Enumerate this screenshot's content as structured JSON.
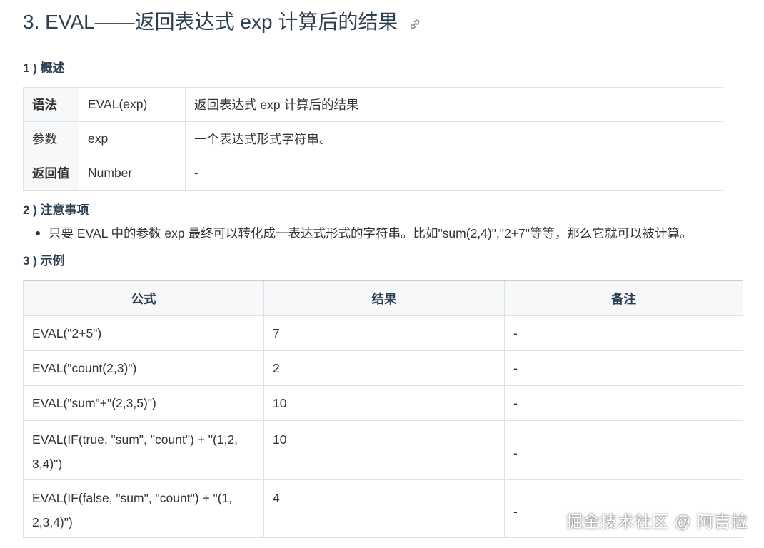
{
  "heading": {
    "title": "3. EVAL——返回表达式 exp 计算后的结果",
    "link_icon": "link-icon"
  },
  "overview": {
    "heading": "1 ) 概述",
    "rows": [
      {
        "key": "语法",
        "value": "EVAL(exp)",
        "desc": "返回表达式 exp 计算后的结果"
      },
      {
        "key": "参数",
        "value": "exp",
        "desc": "一个表达式形式字符串。"
      },
      {
        "key": "返回值",
        "value": "Number",
        "desc": "-"
      }
    ]
  },
  "notes": {
    "heading": "2 ) 注意事项",
    "items": [
      "只要 EVAL 中的参数 exp 最终可以转化成一表达式形式的字符串。比如\"sum(2,4)\",\"2+7\"等等，那么它就可以被计算。"
    ]
  },
  "example": {
    "heading": "3 ) 示例",
    "columns": [
      "公式",
      "结果",
      "备注"
    ],
    "rows": [
      {
        "formula": "EVAL(\"2+5\")",
        "result": "7",
        "note": "-"
      },
      {
        "formula": "EVAL(\"count(2,3)\")",
        "result": "2",
        "note": "-"
      },
      {
        "formula": "EVAL(\"sum\"+\"(2,3,5)\")",
        "result": "10",
        "note": "-"
      },
      {
        "formula_line1": "EVAL(IF(true, \"sum\", \"count\") + \"(1,2,",
        "formula_line2": "3,4)\")",
        "result": "10",
        "note": "-"
      },
      {
        "formula_line1": "EVAL(IF(false, \"sum\", \"count\") + \"(1,",
        "formula_line2": "2,3,4)\")",
        "result": "4",
        "note": "-"
      }
    ]
  },
  "watermark": "掘金技术社区 @ 阿吉拉"
}
